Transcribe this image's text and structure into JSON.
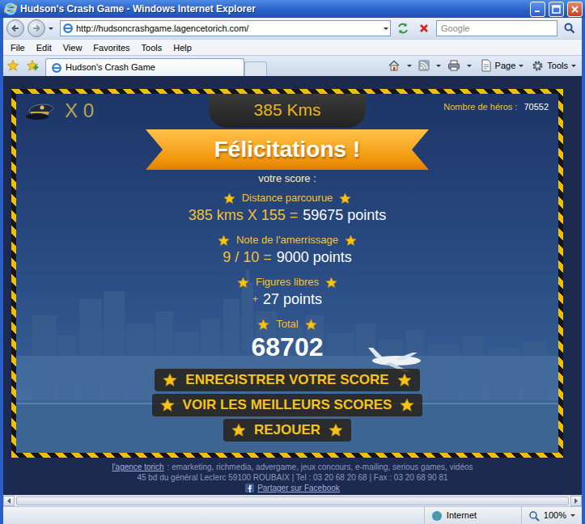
{
  "window": {
    "title": "Hudson's Crash Game - Windows Internet Explorer"
  },
  "address_bar": {
    "url": "http://hudsoncrashgame.lagencetorich.com/",
    "search_placeholder": "Google"
  },
  "menu": [
    "File",
    "Edit",
    "View",
    "Favorites",
    "Tools",
    "Help"
  ],
  "tabs": [
    {
      "label": "Hudson's Crash Game",
      "selected": true
    }
  ],
  "command_bar": [
    "Page",
    "Tools"
  ],
  "game": {
    "lives": "X 0",
    "distance": "385 Kms",
    "heroes": {
      "label": "Nombre de héros :",
      "count": "70552"
    },
    "banner": "Félicitations !",
    "subtitle": "votre score :",
    "scores": [
      {
        "kind": "line",
        "label": "Distance parcourue",
        "formula": "385 kms X 155 =",
        "value": "59675 points"
      },
      {
        "kind": "line",
        "label": "Note de l'amerrissage",
        "formula": "9 / 10 =",
        "value": "9000 points"
      },
      {
        "kind": "bonus",
        "label": "Figures libres",
        "formula": "+",
        "value": "27 points"
      },
      {
        "kind": "total",
        "label": "Total",
        "value": "68702"
      }
    ],
    "buttons": [
      "ENREGISTRER VOTRE SCORE",
      "VOIR LES MEILLEURS SCORES",
      "REJOUER"
    ]
  },
  "footer": {
    "link": "l'agence torich",
    "description": ": emarketing, richmedia, advergame, jeux concours, e-mailing, serious games, vidéos",
    "address": "45 bd du général Leclerc 59100 ROUBAIX | Tel : 03 20 68 20 68 | Fax : 03 20 68 90 81",
    "share": "Partager sur Facebook"
  },
  "status_bar": {
    "zone": "Internet",
    "zoom": "100%"
  }
}
